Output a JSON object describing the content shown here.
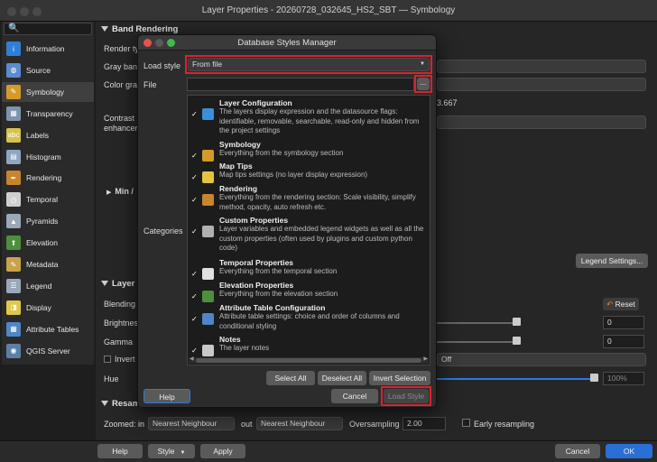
{
  "window": {
    "title": "Layer Properties - 20260728_032645_HS2_SBT — Symbology"
  },
  "sidebar": {
    "search_icon": "🔍",
    "items": [
      {
        "label": "Information",
        "icon": "info-icon",
        "color": "#2f7fd6",
        "glyph": "i"
      },
      {
        "label": "Source",
        "icon": "source-icon",
        "color": "#5b8bd0",
        "glyph": "◍"
      },
      {
        "label": "Symbology",
        "icon": "symbology-icon",
        "color": "#d49a2a",
        "glyph": "✎",
        "selected": true
      },
      {
        "label": "Transparency",
        "icon": "transparency-icon",
        "color": "#7e94ad",
        "glyph": "▦"
      },
      {
        "label": "Labels",
        "icon": "labels-icon",
        "color": "#d6c34a",
        "glyph": "abc"
      },
      {
        "label": "Histogram",
        "icon": "histogram-icon",
        "color": "#8fa6c2",
        "glyph": "▤"
      },
      {
        "label": "Rendering",
        "icon": "rendering-icon",
        "color": "#c9842e",
        "glyph": "✒"
      },
      {
        "label": "Temporal",
        "icon": "temporal-icon",
        "color": "#cfcfcf",
        "glyph": "◷"
      },
      {
        "label": "Pyramids",
        "icon": "pyramids-icon",
        "color": "#9aa8b8",
        "glyph": "▲"
      },
      {
        "label": "Elevation",
        "icon": "elevation-icon",
        "color": "#4d8f3a",
        "glyph": "⬆"
      },
      {
        "label": "Metadata",
        "icon": "metadata-icon",
        "color": "#c9a24a",
        "glyph": "✎"
      },
      {
        "label": "Legend",
        "icon": "legend-icon",
        "color": "#9aa8b8",
        "glyph": "☰"
      },
      {
        "label": "Display",
        "icon": "display-icon",
        "color": "#e0c84a",
        "glyph": "◨"
      },
      {
        "label": "Attribute Tables",
        "icon": "attribute-tables-icon",
        "color": "#4f86c6",
        "glyph": "▦"
      },
      {
        "label": "QGIS Server",
        "icon": "qgis-server-icon",
        "color": "#5c7fa8",
        "glyph": "◉"
      }
    ]
  },
  "main": {
    "band_rendering": "Band Rendering",
    "render_type_label": "Render ty",
    "gray_band_label": "Gray ban",
    "color_gradient_label": "Color gra",
    "contrast_label": "Contrast",
    "contrast_label2": "enhancer",
    "min_label": "Min /",
    "value_fragment": "3.667",
    "legend_settings_button": "Legend Settings...",
    "layer_rendering": "Layer R",
    "blending_label": "Blending",
    "brightness_label": "Brightnes",
    "gamma_label": "Gamma",
    "invert_label": "Invert",
    "hue_label": "Hue",
    "reset_button": "Reset",
    "brightness_value": "0",
    "gamma_value": "0",
    "invert_value": "Off",
    "hue_value": "100%",
    "resampling": "Resamp",
    "zoomed_in_label": "Zoomed: in",
    "zoomed_in_value": "Nearest Neighbour",
    "out_label": "out",
    "zoomed_out_value": "Nearest Neighbour",
    "oversampling_label": "Oversampling",
    "oversampling_value": "2.00",
    "early_resampling_label": "Early resampling"
  },
  "bottom": {
    "help": "Help",
    "style": "Style",
    "apply": "Apply",
    "cancel": "Cancel",
    "ok": "OK"
  },
  "dialog": {
    "title": "Database Styles Manager",
    "load_style_label": "Load style",
    "load_style_value": "From file",
    "file_label": "File",
    "file_value": "",
    "browse_button": "...",
    "categories_label": "Categories",
    "categories": [
      {
        "title": "Layer Configuration",
        "desc": "The layers display expression and the datasource flags: identifiable, removable, searchable, read-only and hidden from the project settings",
        "icon": "gear-icon",
        "color": "#3a8fd8"
      },
      {
        "title": "Symbology",
        "desc": "Everything from the symbology section",
        "icon": "symbology-icon",
        "color": "#d49a2a"
      },
      {
        "title": "Map Tips",
        "desc": "Map tips settings (no layer display expression)",
        "icon": "map-tips-icon",
        "color": "#e2c440"
      },
      {
        "title": "Rendering",
        "desc": "Everything from the rendering section: Scale visibility, simplify method, opacity, auto refresh etc.",
        "icon": "rendering-icon",
        "color": "#c9842e"
      },
      {
        "title": "Custom Properties",
        "desc": "Layer variables and embedded legend widgets as well as all the custom properties (often used by plugins and custom python code)",
        "icon": "wrench-icon",
        "color": "#b0b0b0"
      },
      {
        "title": "Temporal Properties",
        "desc": "Everything from the temporal section",
        "icon": "clock-icon",
        "color": "#e0e0e0"
      },
      {
        "title": "Elevation Properties",
        "desc": "Everything from the elevation section",
        "icon": "elevation-icon",
        "color": "#4d8f3a"
      },
      {
        "title": "Attribute Table Configuration",
        "desc": "Attribute table settings: choice and order of columns and conditional styling",
        "icon": "table-icon",
        "color": "#4f86c6"
      },
      {
        "title": "Notes",
        "desc": "The layer notes",
        "icon": "notes-icon",
        "color": "#c8c8c8"
      }
    ],
    "check_mark": "✓",
    "select_all": "Select All",
    "deselect_all": "Deselect All",
    "invert_selection": "Invert Selection",
    "help": "Help",
    "cancel": "Cancel",
    "load_style": "Load Style"
  },
  "colors": {
    "highlight": "#d8222e",
    "accent": "#2a7ae2"
  }
}
